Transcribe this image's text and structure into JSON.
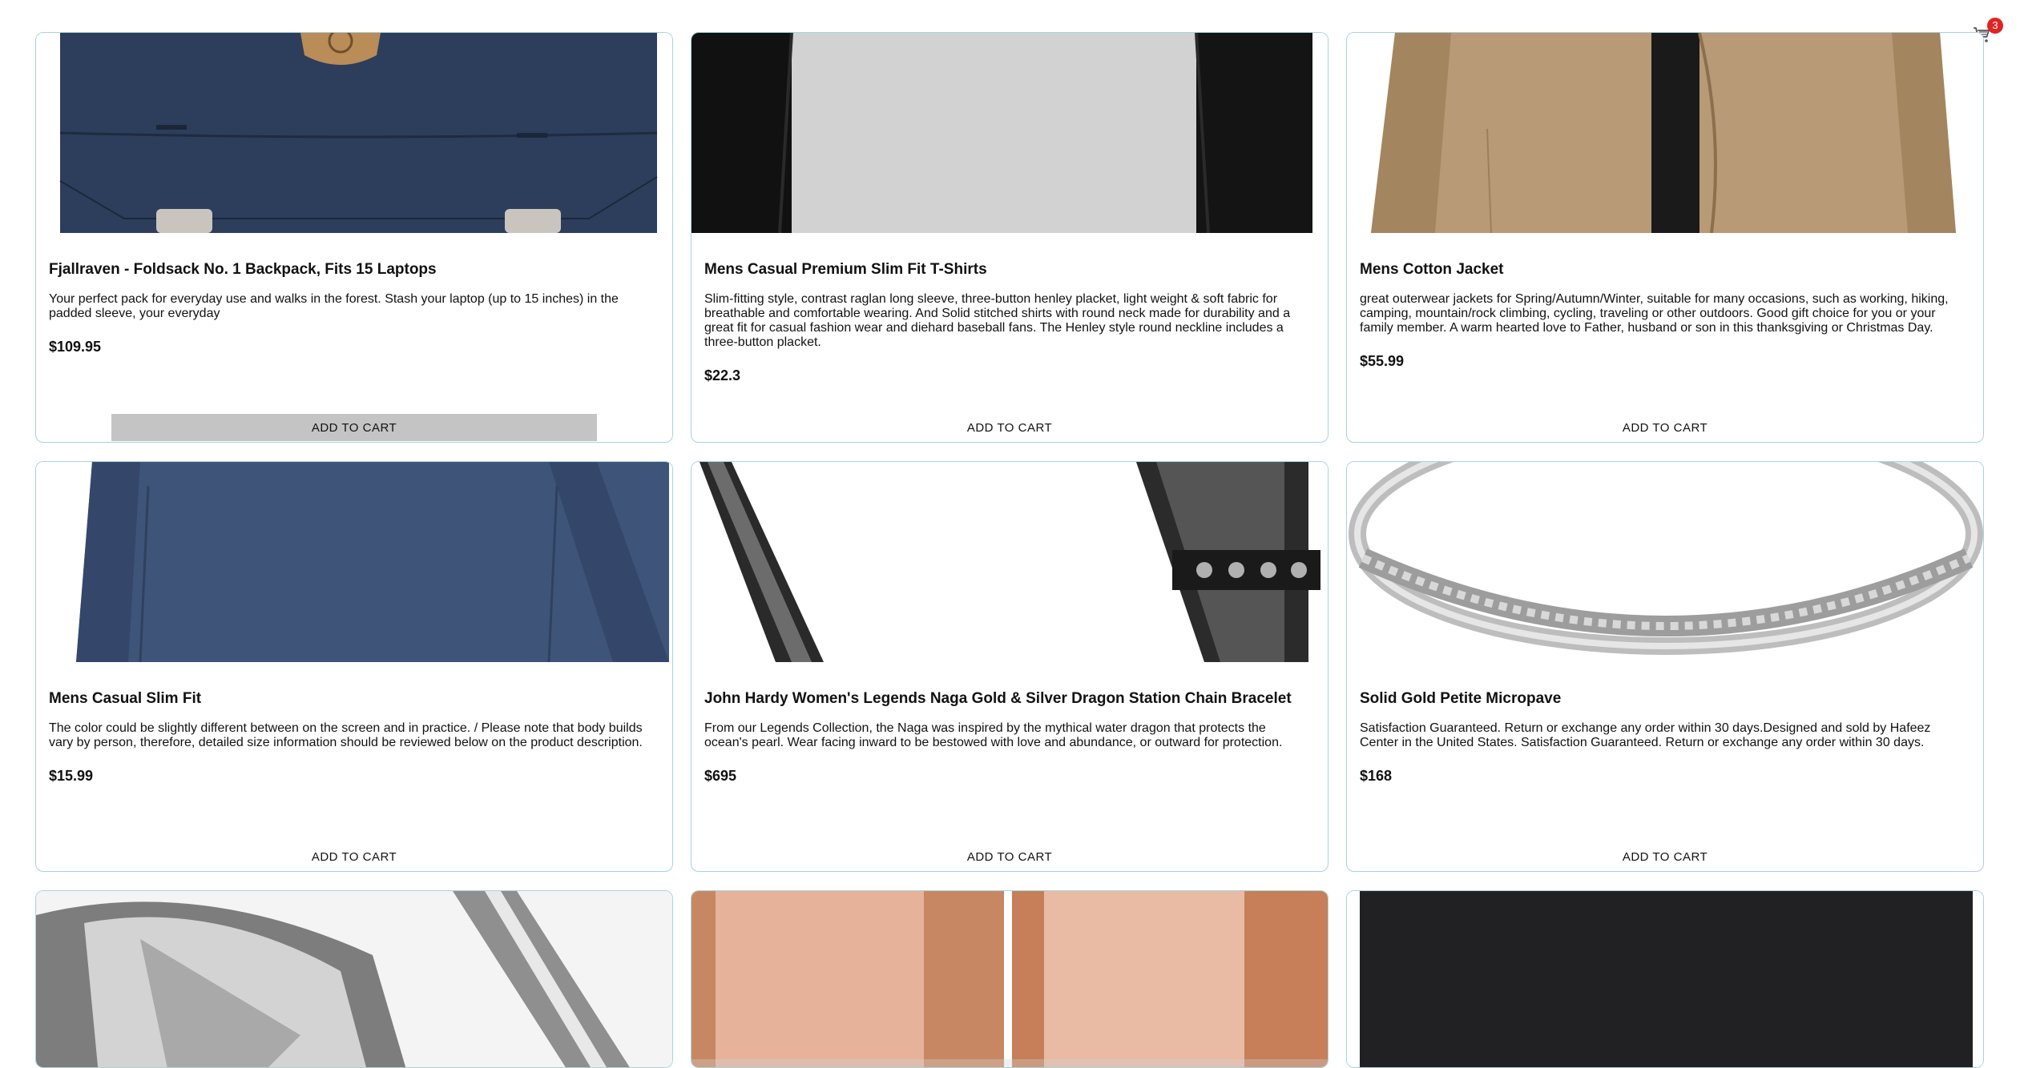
{
  "cart": {
    "count": "3",
    "icon": "cart-icon"
  },
  "products": [
    {
      "title": "Fjallraven - Foldsack No. 1 Backpack, Fits 15 Laptops",
      "description": "Your perfect pack for everyday use and walks in the forest. Stash your laptop (up to 15 inches) in the padded sleeve, your everyday",
      "price": "$109.95",
      "button": "ADD TO CART",
      "image": "navy-backpack"
    },
    {
      "title": "Mens Casual Premium Slim Fit T-Shirts",
      "description": "Slim-fitting style, contrast raglan long sleeve, three-button henley placket, light weight & soft fabric for breathable and comfortable wearing. And Solid stitched shirts with round neck made for durability and a great fit for casual fashion wear and diehard baseball fans. The Henley style round neckline includes a three-button placket.",
      "price": "$22.3",
      "button": "ADD TO CART",
      "image": "raglan-tshirt"
    },
    {
      "title": "Mens Cotton Jacket",
      "description": "great outerwear jackets for Spring/Autumn/Winter, suitable for many occasions, such as working, hiking, camping, mountain/rock climbing, cycling, traveling or other outdoors. Good gift choice for you or your family member. A warm hearted love to Father, husband or son in this thanksgiving or Christmas Day.",
      "price": "$55.99",
      "button": "ADD TO CART",
      "image": "khaki-jacket"
    },
    {
      "title": "Mens Casual Slim Fit",
      "description": "The color could be slightly different between on the screen and in practice. / Please note that body builds vary by person, therefore, detailed size information should be reviewed below on the product description.",
      "price": "$15.99",
      "button": "ADD TO CART",
      "image": "blue-longsleeve"
    },
    {
      "title": "John Hardy Women's Legends Naga Gold & Silver Dragon Station Chain Bracelet",
      "description": "From our Legends Collection, the Naga was inspired by the mythical water dragon that protects the ocean's pearl. Wear facing inward to be bestowed with love and abundance, or outward for protection.",
      "price": "$695",
      "button": "ADD TO CART",
      "image": "dragon-bracelet"
    },
    {
      "title": "Solid Gold Petite Micropave",
      "description": "Satisfaction Guaranteed. Return or exchange any order within 30 days.Designed and sold by Hafeez Center in the United States. Satisfaction Guaranteed. Return or exchange any order within 30 days.",
      "price": "$168",
      "button": "ADD TO CART",
      "image": "silver-ring"
    }
  ],
  "partial_cards": [
    {
      "image": "diamond-ring"
    },
    {
      "image": "rose-gold-rings"
    },
    {
      "image": "dark-device"
    }
  ]
}
